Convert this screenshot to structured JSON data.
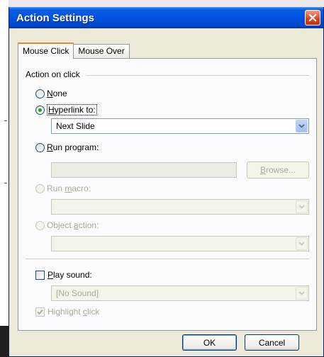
{
  "dialog": {
    "title": "Action Settings"
  },
  "tabs": [
    {
      "label": "Mouse Click",
      "active": true
    },
    {
      "label": "Mouse Over",
      "active": false
    }
  ],
  "group": {
    "label": "Action on click"
  },
  "options": {
    "none": {
      "prefix": "",
      "accel": "N",
      "rest": "one",
      "checked": false,
      "enabled": true
    },
    "hyperlink": {
      "prefix": "",
      "accel": "H",
      "rest": "yperlink to:",
      "checked": true,
      "enabled": true
    },
    "run_program": {
      "prefix": "",
      "accel": "R",
      "rest": "un program:",
      "checked": false,
      "enabled": true
    },
    "run_macro": {
      "prefix": "Run ",
      "accel": "m",
      "rest": "acro:",
      "checked": false,
      "enabled": false
    },
    "object_action": {
      "prefix": "Object ",
      "accel": "a",
      "rest": "ction:",
      "checked": false,
      "enabled": false
    }
  },
  "hyperlink_select": {
    "value": "Next Slide"
  },
  "browse_button": {
    "accel": "B",
    "rest": "rowse..."
  },
  "play_sound": {
    "prefix": "",
    "accel": "P",
    "rest": "lay sound:",
    "checked": false
  },
  "sound_select": {
    "value": "[No Sound]"
  },
  "highlight_click": {
    "prefix": "Highlight ",
    "accel": "c",
    "rest": "lick",
    "checked": true
  },
  "buttons": {
    "ok": "OK",
    "cancel": "Cancel"
  },
  "colors": {
    "titlebar": "#0054e3",
    "close": "#d9411c",
    "dialog_bg": "#ece9d8",
    "radio_dot": "#21a121"
  }
}
